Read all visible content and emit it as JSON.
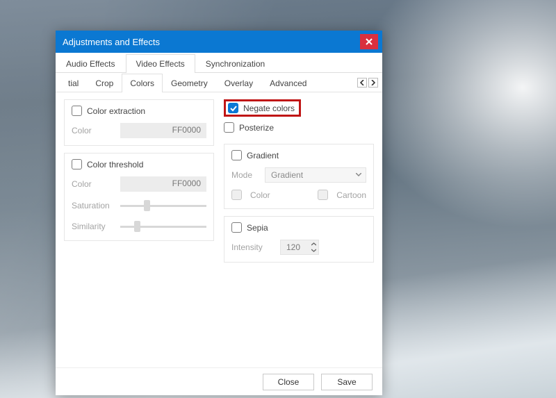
{
  "window": {
    "title": "Adjustments and Effects"
  },
  "tabs": {
    "main": [
      "Audio Effects",
      "Video Effects",
      "Synchronization"
    ],
    "main_active": 1,
    "sub": [
      "tial",
      "Crop",
      "Colors",
      "Geometry",
      "Overlay",
      "Advanced"
    ],
    "sub_active": 2
  },
  "left": {
    "extraction": {
      "label": "Color extraction",
      "color_label": "Color",
      "color_value": "FF0000"
    },
    "threshold": {
      "label": "Color threshold",
      "color_label": "Color",
      "color_value": "FF0000",
      "saturation_label": "Saturation",
      "similarity_label": "Similarity"
    }
  },
  "right": {
    "negate": {
      "label": "Negate colors",
      "checked": true
    },
    "posterize": {
      "label": "Posterize"
    },
    "gradient": {
      "label": "Gradient",
      "mode_label": "Mode",
      "mode_value": "Gradient",
      "color_label": "Color",
      "cartoon_label": "Cartoon"
    },
    "sepia": {
      "label": "Sepia",
      "intensity_label": "Intensity",
      "intensity_value": "120"
    }
  },
  "footer": {
    "close": "Close",
    "save": "Save"
  }
}
